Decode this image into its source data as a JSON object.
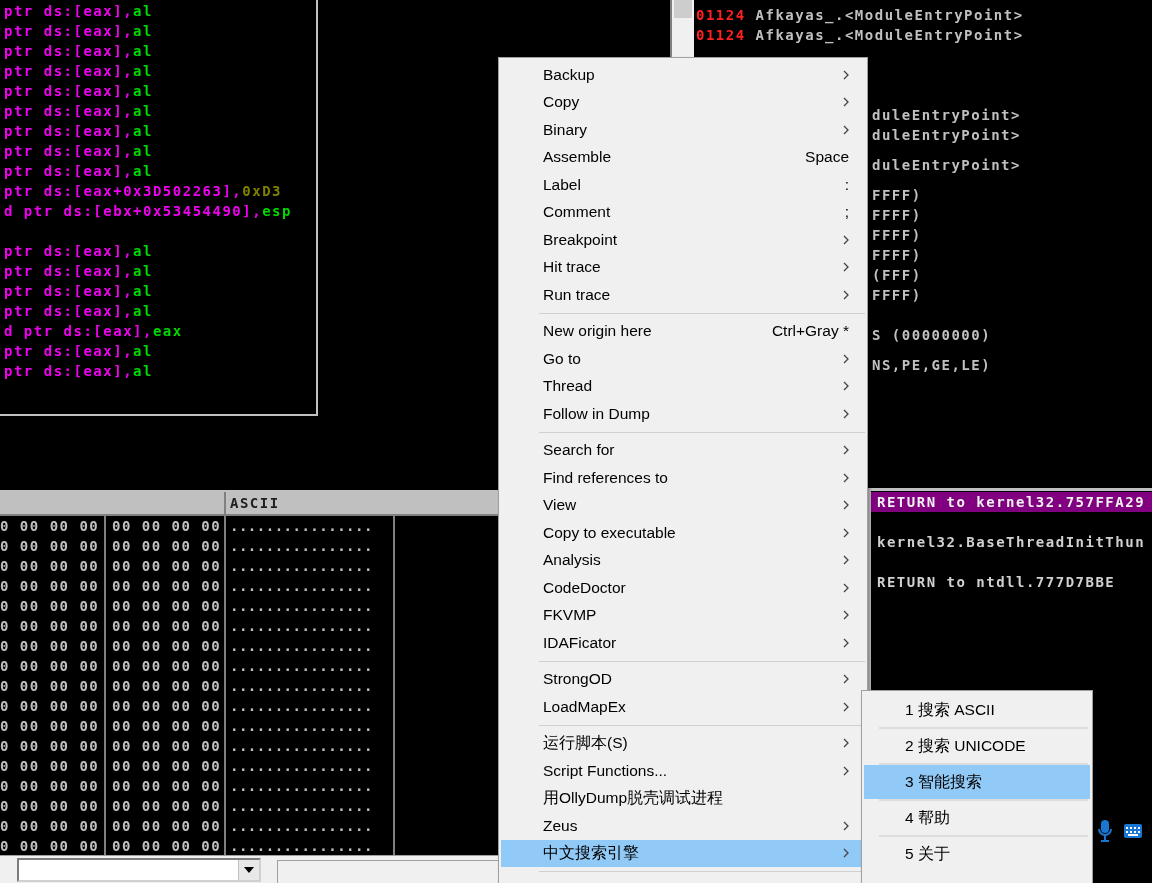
{
  "disassembly": {
    "lines": [
      {
        "text": "ptr ds:[eax],",
        "operand": "al",
        "kind": "register"
      },
      {
        "text": "ptr ds:[eax],",
        "operand": "al",
        "kind": "register"
      },
      {
        "text": "ptr ds:[eax],",
        "operand": "al",
        "kind": "register"
      },
      {
        "text": "ptr ds:[eax],",
        "operand": "al",
        "kind": "register"
      },
      {
        "text": "ptr ds:[eax],",
        "operand": "al",
        "kind": "register"
      },
      {
        "text": "ptr ds:[eax],",
        "operand": "al",
        "kind": "register"
      },
      {
        "text": "ptr ds:[eax],",
        "operand": "al",
        "kind": "register"
      },
      {
        "text": "ptr ds:[eax],",
        "operand": "al",
        "kind": "register"
      },
      {
        "text": "ptr ds:[eax],",
        "operand": "al",
        "kind": "register"
      },
      {
        "text": "ptr ds:[eax+0x3D502263],",
        "operand": "0xD3",
        "kind": "immediate"
      },
      {
        "text": "d ptr ds:[ebx+0x53454490],",
        "operand": "esp",
        "kind": "register"
      },
      {
        "kind": "blank"
      },
      {
        "text": "ptr ds:[eax],",
        "operand": "al",
        "kind": "register"
      },
      {
        "text": "ptr ds:[eax],",
        "operand": "al",
        "kind": "register"
      },
      {
        "text": "ptr ds:[eax],",
        "operand": "al",
        "kind": "register"
      },
      {
        "text": "ptr ds:[eax],",
        "operand": "al",
        "kind": "register"
      },
      {
        "text": "d ptr ds:[eax],",
        "operand": "eax",
        "kind": "register"
      },
      {
        "text": "ptr ds:[eax],",
        "operand": "al",
        "kind": "register"
      },
      {
        "text": "ptr ds:[eax],",
        "operand": "al",
        "kind": "register"
      }
    ]
  },
  "registers": {
    "top_lines": [
      {
        "value": "01124",
        "text": "Afkayas_.<ModuleEntryPoint>"
      },
      {
        "value": "01124",
        "text": "Afkayas_.<ModuleEntryPoint>"
      }
    ],
    "side_lines": [
      "duleEntryPoint>",
      "duleEntryPoint>",
      "duleEntryPoint>",
      "FFFF)",
      "FFFF)",
      "FFFF)",
      "FFFF)",
      "(FFF)",
      "FFFF)",
      "S (00000000)",
      "NS,PE,GE,LE)"
    ]
  },
  "dump": {
    "columns": [
      "ASCII"
    ],
    "rows": [
      {
        "hex_1": "0 00 00 00",
        "hex_2": "00 00 00 00",
        "ascii": "................"
      },
      {
        "hex_1": "0 00 00 00",
        "hex_2": "00 00 00 00",
        "ascii": "................"
      },
      {
        "hex_1": "0 00 00 00",
        "hex_2": "00 00 00 00",
        "ascii": "................"
      },
      {
        "hex_1": "0 00 00 00",
        "hex_2": "00 00 00 00",
        "ascii": "................"
      },
      {
        "hex_1": "0 00 00 00",
        "hex_2": "00 00 00 00",
        "ascii": "................"
      },
      {
        "hex_1": "0 00 00 00",
        "hex_2": "00 00 00 00",
        "ascii": "................"
      },
      {
        "hex_1": "0 00 00 00",
        "hex_2": "00 00 00 00",
        "ascii": "................"
      },
      {
        "hex_1": "0 00 00 00",
        "hex_2": "00 00 00 00",
        "ascii": "................"
      },
      {
        "hex_1": "0 00 00 00",
        "hex_2": "00 00 00 00",
        "ascii": "................"
      },
      {
        "hex_1": "0 00 00 00",
        "hex_2": "00 00 00 00",
        "ascii": "................"
      },
      {
        "hex_1": "0 00 00 00",
        "hex_2": "00 00 00 00",
        "ascii": "................"
      },
      {
        "hex_1": "0 00 00 00",
        "hex_2": "00 00 00 00",
        "ascii": "................"
      },
      {
        "hex_1": "0 00 00 00",
        "hex_2": "00 00 00 00",
        "ascii": "................"
      },
      {
        "hex_1": "0 00 00 00",
        "hex_2": "00 00 00 00",
        "ascii": "................"
      },
      {
        "hex_1": "0 00 00 00",
        "hex_2": "00 00 00 00",
        "ascii": "................"
      },
      {
        "hex_1": "0 00 00 00",
        "hex_2": "00 00 00 00",
        "ascii": "................"
      },
      {
        "hex_1": "0 00 00 00",
        "hex_2": "00 00 00 00",
        "ascii": "................"
      }
    ]
  },
  "stack": {
    "lines": [
      {
        "text": "RETURN to kernel32.757FFA29",
        "selected": true
      },
      {
        "text": "kernel32.BaseThreadInitThun",
        "selected": false
      },
      {
        "text": "RETURN to ntdll.777D7BBE",
        "selected": false
      }
    ]
  },
  "context_menu": {
    "items": [
      {
        "kind": "item",
        "label": "Backup",
        "submenu": true,
        "selected": false
      },
      {
        "kind": "item",
        "label": "Copy",
        "submenu": true,
        "selected": false
      },
      {
        "kind": "item",
        "label": "Binary",
        "submenu": true,
        "selected": false
      },
      {
        "kind": "item",
        "label": "Assemble",
        "shortcut": "Space",
        "submenu": false,
        "selected": false
      },
      {
        "kind": "item",
        "label": "Label",
        "shortcut": ":",
        "submenu": false,
        "selected": false
      },
      {
        "kind": "item",
        "label": "Comment",
        "shortcut": ";",
        "submenu": false,
        "selected": false
      },
      {
        "kind": "item",
        "label": "Breakpoint",
        "submenu": true,
        "selected": false
      },
      {
        "kind": "item",
        "label": "Hit trace",
        "submenu": true,
        "selected": false
      },
      {
        "kind": "item",
        "label": "Run trace",
        "submenu": true,
        "selected": false
      },
      {
        "kind": "separator"
      },
      {
        "kind": "item",
        "label": "New origin here",
        "shortcut": "Ctrl+Gray *",
        "submenu": false,
        "selected": false
      },
      {
        "kind": "item",
        "label": "Go to",
        "submenu": true,
        "selected": false
      },
      {
        "kind": "item",
        "label": "Thread",
        "submenu": true,
        "selected": false
      },
      {
        "kind": "item",
        "label": "Follow in Dump",
        "submenu": true,
        "selected": false
      },
      {
        "kind": "separator"
      },
      {
        "kind": "item",
        "label": "Search for",
        "submenu": true,
        "selected": false
      },
      {
        "kind": "item",
        "label": "Find references to",
        "submenu": true,
        "selected": false
      },
      {
        "kind": "item",
        "label": "View",
        "submenu": true,
        "selected": false
      },
      {
        "kind": "item",
        "label": "Copy to executable",
        "submenu": true,
        "selected": false
      },
      {
        "kind": "item",
        "label": "Analysis",
        "submenu": true,
        "selected": false
      },
      {
        "kind": "item",
        "label": "CodeDoctor",
        "submenu": true,
        "selected": false
      },
      {
        "kind": "item",
        "label": "FKVMP",
        "submenu": true,
        "selected": false
      },
      {
        "kind": "item",
        "label": "IDAFicator",
        "submenu": true,
        "selected": false
      },
      {
        "kind": "separator"
      },
      {
        "kind": "item",
        "label": "StrongOD",
        "submenu": true,
        "selected": false
      },
      {
        "kind": "item",
        "label": "LoadMapEx",
        "submenu": true,
        "selected": false
      },
      {
        "kind": "separator"
      },
      {
        "kind": "item",
        "label": "运行脚本(S)",
        "submenu": true,
        "selected": false
      },
      {
        "kind": "item",
        "label": "Script Functions...",
        "submenu": true,
        "selected": false
      },
      {
        "kind": "item",
        "label": "用OllyDump脱壳调试进程",
        "submenu": false,
        "selected": false
      },
      {
        "kind": "item",
        "label": "Zeus",
        "submenu": true,
        "selected": false
      },
      {
        "kind": "item",
        "label": "中文搜索引擎",
        "submenu": true,
        "selected": true
      },
      {
        "kind": "separator"
      }
    ]
  },
  "submenu": {
    "items": [
      {
        "label": "1 搜索 ASCII",
        "selected": false
      },
      {
        "label": "2 搜索 UNICODE",
        "selected": false
      },
      {
        "label": "3 智能搜索",
        "selected": true
      },
      {
        "label": "4 帮助",
        "selected": false
      },
      {
        "label": "5 关于",
        "selected": false
      }
    ]
  }
}
